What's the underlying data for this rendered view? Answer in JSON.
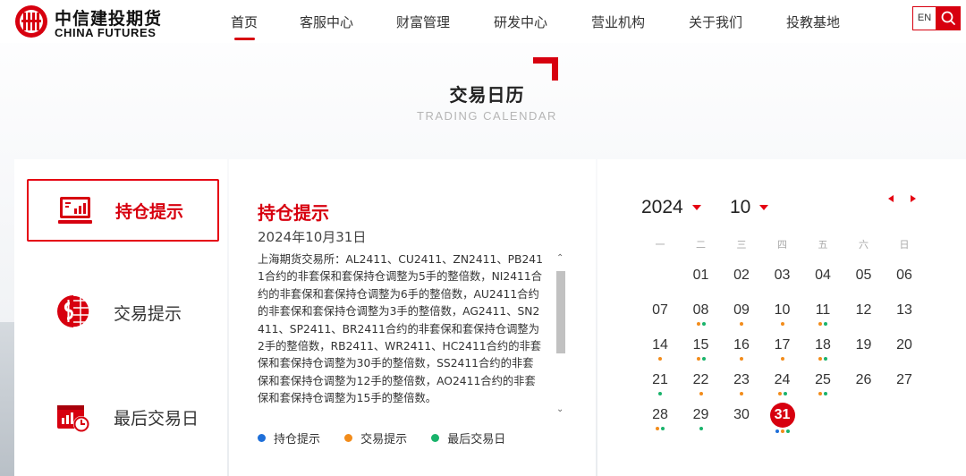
{
  "header": {
    "logo_cn": "中信建投期货",
    "logo_en": "CHINA FUTURES",
    "nav": [
      {
        "label": "首页",
        "active": true
      },
      {
        "label": "客服中心"
      },
      {
        "label": "财富管理"
      },
      {
        "label": "研发中心"
      },
      {
        "label": "营业机构"
      },
      {
        "label": "关于我们"
      },
      {
        "label": "投教基地"
      }
    ],
    "lang": "EN",
    "search_icon": "search-icon"
  },
  "title": {
    "cn": "交易日历",
    "en": "TRADING CALENDAR"
  },
  "categories": [
    {
      "label": "持仓提示",
      "icon": "position-monitor-icon",
      "active": true
    },
    {
      "label": "交易提示",
      "icon": "dollar-globe-icon"
    },
    {
      "label": "最后交易日",
      "icon": "chart-clock-icon"
    }
  ],
  "detail": {
    "title": "持仓提示",
    "date": "2024年10月31日",
    "text": "上海期货交易所：AL2411、CU2411、ZN2411、PB2411合约的非套保和套保持仓调整为5手的整倍数，NI2411合约的非套保和套保持仓调整为6手的整倍数，AU2411合约的非套保和套保持仓调整为3手的整倍数，AG2411、SN2411、SP2411、BR2411合约的非套保和套保持仓调整为2手的整倍数，RB2411、WR2411、HC2411合约的非套保和套保持仓调整为30手的整倍数，SS2411合约的非套保和套保持仓调整为12手的整倍数，AO2411合约的非套保和套保持仓调整为15手的整倍数。"
  },
  "legend": [
    {
      "label": "持仓提示",
      "color": "#1e6fd9"
    },
    {
      "label": "交易提示",
      "color": "#f28c1b"
    },
    {
      "label": "最后交易日",
      "color": "#19b36b"
    }
  ],
  "calendar": {
    "year": "2024",
    "month": "10",
    "weekdays": [
      "一",
      "二",
      "三",
      "四",
      "五",
      "六",
      "日"
    ],
    "colors": {
      "position": "#1e6fd9",
      "trade": "#f28c1b",
      "last": "#19b36b"
    },
    "days": [
      {
        "d": "01",
        "col": 1,
        "row": 0,
        "dots": []
      },
      {
        "d": "02",
        "col": 2,
        "row": 0,
        "dots": []
      },
      {
        "d": "03",
        "col": 3,
        "row": 0,
        "dots": []
      },
      {
        "d": "04",
        "col": 4,
        "row": 0,
        "dots": []
      },
      {
        "d": "05",
        "col": 5,
        "row": 0,
        "dots": []
      },
      {
        "d": "06",
        "col": 6,
        "row": 0,
        "dots": []
      },
      {
        "d": "07",
        "col": 0,
        "row": 1,
        "dots": []
      },
      {
        "d": "08",
        "col": 1,
        "row": 1,
        "dots": [
          "trade",
          "last"
        ]
      },
      {
        "d": "09",
        "col": 2,
        "row": 1,
        "dots": [
          "trade"
        ]
      },
      {
        "d": "10",
        "col": 3,
        "row": 1,
        "dots": [
          "trade"
        ]
      },
      {
        "d": "11",
        "col": 4,
        "row": 1,
        "dots": [
          "trade",
          "last"
        ]
      },
      {
        "d": "12",
        "col": 5,
        "row": 1,
        "dots": []
      },
      {
        "d": "13",
        "col": 6,
        "row": 1,
        "dots": []
      },
      {
        "d": "14",
        "col": 0,
        "row": 2,
        "dots": [
          "trade"
        ]
      },
      {
        "d": "15",
        "col": 1,
        "row": 2,
        "dots": [
          "trade",
          "last"
        ]
      },
      {
        "d": "16",
        "col": 2,
        "row": 2,
        "dots": [
          "trade"
        ]
      },
      {
        "d": "17",
        "col": 3,
        "row": 2,
        "dots": [
          "trade"
        ]
      },
      {
        "d": "18",
        "col": 4,
        "row": 2,
        "dots": [
          "trade",
          "last"
        ]
      },
      {
        "d": "19",
        "col": 5,
        "row": 2,
        "dots": []
      },
      {
        "d": "20",
        "col": 6,
        "row": 2,
        "dots": []
      },
      {
        "d": "21",
        "col": 0,
        "row": 3,
        "dots": [
          "last"
        ]
      },
      {
        "d": "22",
        "col": 1,
        "row": 3,
        "dots": [
          "trade"
        ]
      },
      {
        "d": "23",
        "col": 2,
        "row": 3,
        "dots": [
          "trade"
        ]
      },
      {
        "d": "24",
        "col": 3,
        "row": 3,
        "dots": [
          "trade",
          "last"
        ]
      },
      {
        "d": "25",
        "col": 4,
        "row": 3,
        "dots": [
          "trade",
          "last"
        ]
      },
      {
        "d": "26",
        "col": 5,
        "row": 3,
        "dots": []
      },
      {
        "d": "27",
        "col": 6,
        "row": 3,
        "dots": []
      },
      {
        "d": "28",
        "col": 0,
        "row": 4,
        "dots": [
          "trade",
          "last"
        ]
      },
      {
        "d": "29",
        "col": 1,
        "row": 4,
        "dots": [
          "last"
        ]
      },
      {
        "d": "30",
        "col": 2,
        "row": 4,
        "dots": []
      },
      {
        "d": "31",
        "col": 3,
        "row": 4,
        "dots": [
          "position",
          "trade",
          "last"
        ],
        "selected": true
      }
    ]
  }
}
